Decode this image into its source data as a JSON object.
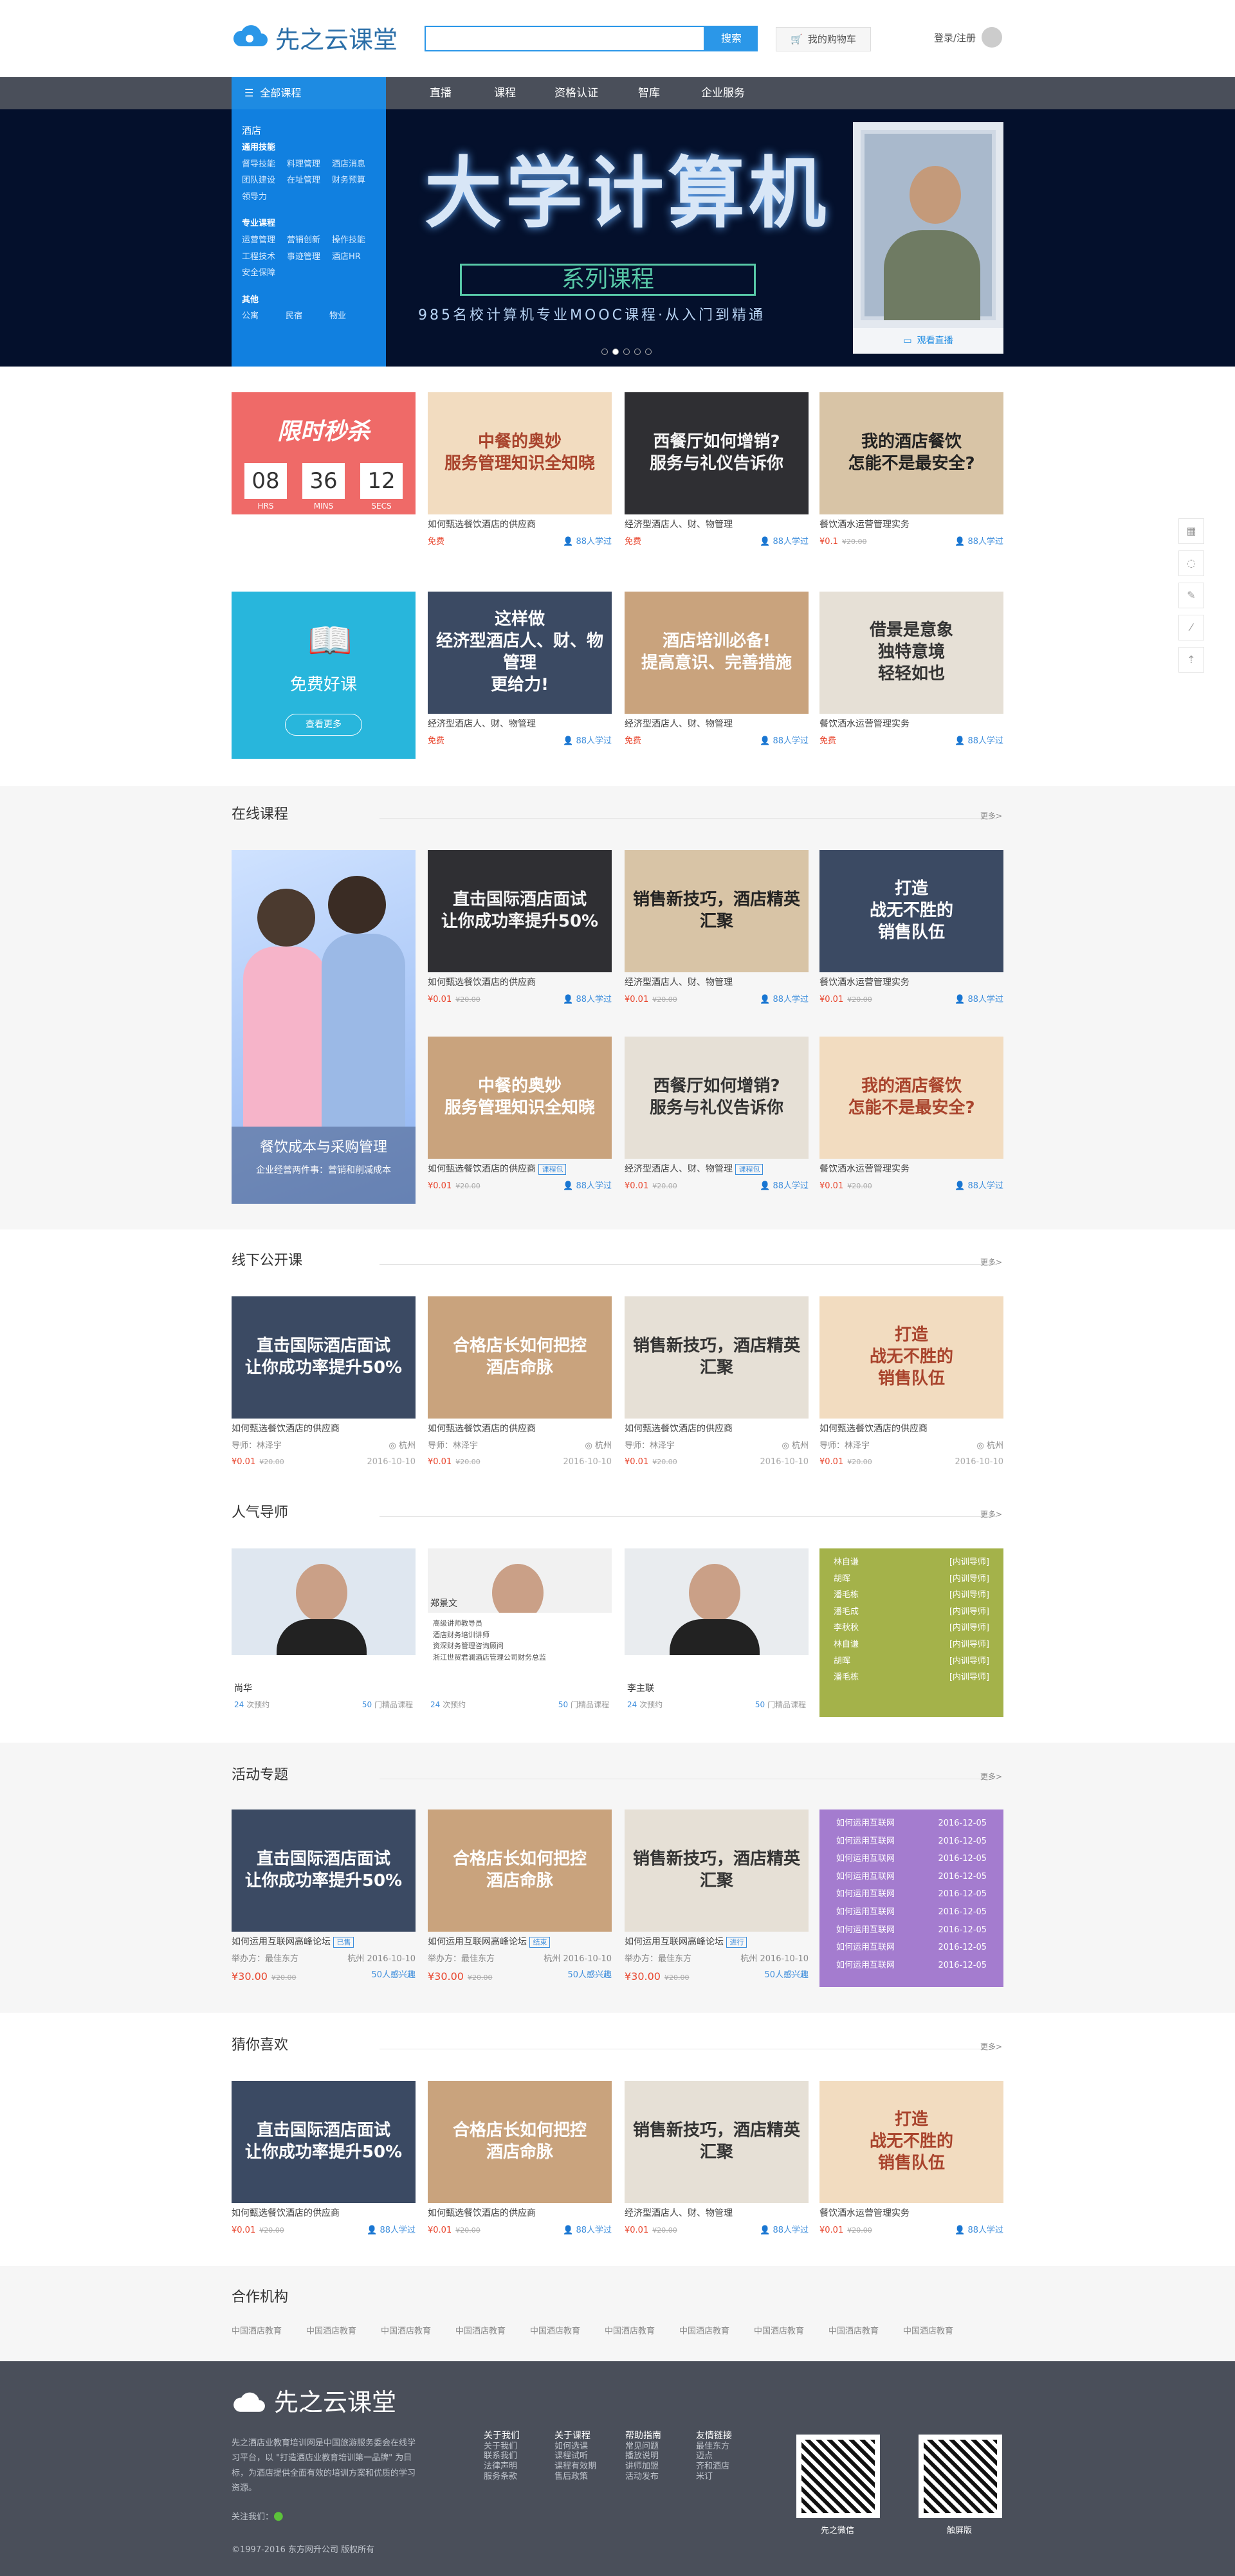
{
  "header": {
    "logo_text": "先之云课堂",
    "search_button": "搜索",
    "cart": "我的购物车",
    "login": "登录/注册"
  },
  "nav": {
    "all": "全部课程",
    "items": [
      "直播",
      "课程",
      "资格认证",
      "智库",
      "企业服务"
    ]
  },
  "sidecat": {
    "g1": "酒店",
    "g1_sub": "通用技能",
    "r1": [
      "督导技能",
      "料理管理",
      "酒店消息"
    ],
    "r2": [
      "团队建设",
      "在址管理",
      "财务预算"
    ],
    "r3": [
      "领导力"
    ],
    "g2": "专业课程",
    "r4": [
      "运营管理",
      "营销创新",
      "操作技能"
    ],
    "r5": [
      "工程技术",
      "事迹管理",
      "酒店HR"
    ],
    "r6": [
      "安全保障"
    ],
    "g3": "其他",
    "r7": [
      "公寓",
      "民宿",
      "物业"
    ]
  },
  "banner": {
    "title": "大学计算机",
    "subtitle": "系列课程",
    "tagline": "985名校计算机专业MOOC课程·从入门到精通",
    "teacher_btn": "观看直播"
  },
  "flash": {
    "title": "限时秒杀",
    "h": "08",
    "m": "36",
    "s": "12",
    "h_l": "HRS",
    "m_l": "MINS",
    "s_l": "SECS"
  },
  "free": {
    "title": "免费好课",
    "btn": "查看更多"
  },
  "row1": [
    {
      "cap": "中餐的奥妙\n服务管理知识全知晓",
      "title": "如何甄选餐饮酒店的供应商",
      "price": "免费",
      "learn": "88人学过"
    },
    {
      "cap": "西餐厅如何增销?\n服务与礼仪告诉你",
      "title": "经济型酒店人、财、物管理",
      "price": "免费",
      "learn": "88人学过"
    },
    {
      "cap": "我的酒店餐饮\n怎能不是最安全?",
      "title": "餐饮酒水运营管理实务",
      "price": "¥0.1",
      "old": "¥20.00",
      "learn": "88人学过"
    }
  ],
  "row2": [
    {
      "cap": "这样做\n经济型酒店人、财、物管理\n更给力!",
      "title": "经济型酒店人、财、物管理",
      "price": "免费",
      "learn": "88人学过"
    },
    {
      "cap": "酒店培训必备!\n提高意识、完善措施",
      "title": "经济型酒店人、财、物管理",
      "price": "免费",
      "learn": "88人学过"
    },
    {
      "cap": "借景是意象\n独特意境\n轻轻如也",
      "title": "餐饮酒水运营管理实务",
      "price": "免费",
      "learn": "88人学过"
    }
  ],
  "online": {
    "title": "在线课程",
    "more": "更多>",
    "promo_title": "餐饮成本与采购管理",
    "promo_sub": "企业经营两件事：营销和削减成本",
    "cards": [
      {
        "cap": "直击国际酒店面试\n让你成功率提升50%",
        "title": "如何甄选餐饮酒店的供应商",
        "price": "¥0.01",
        "old": "¥20.00",
        "learn": "88人学过"
      },
      {
        "cap": "销售新技巧，酒店精英汇聚",
        "title": "经济型酒店人、财、物管理",
        "price": "¥0.01",
        "old": "¥20.00",
        "learn": "88人学过"
      },
      {
        "cap": "打造\n战无不胜的\n销售队伍",
        "title": "餐饮酒水运营管理实务",
        "price": "¥0.01",
        "old": "¥20.00",
        "learn": "88人学过"
      },
      {
        "cap": "中餐的奥妙\n服务管理知识全知晓",
        "title": "如何甄选餐饮酒店的供应商",
        "tag": "课程包",
        "price": "¥0.01",
        "old": "¥20.00",
        "learn": "88人学过"
      },
      {
        "cap": "西餐厅如何增销?\n服务与礼仪告诉你",
        "title": "经济型酒店人、财、物管理",
        "tag": "课程包",
        "price": "¥0.01",
        "old": "¥20.00",
        "learn": "88人学过"
      },
      {
        "cap": "我的酒店餐饮\n怎能不是最安全?",
        "title": "餐饮酒水运营管理实务",
        "price": "¥0.01",
        "old": "¥20.00",
        "learn": "88人学过"
      }
    ]
  },
  "offline": {
    "title": "线下公开课",
    "more": "更多>",
    "cards": [
      {
        "cap": "直击国际酒店面试\n让你成功率提升50%",
        "title": "如何甄选餐饮酒店的供应商",
        "mentor": "导师：林泽宇",
        "city": "杭州",
        "price": "¥0.01",
        "old": "¥20.00",
        "date": "2016-10-10"
      },
      {
        "cap": "合格店长如何把控\n酒店命脉",
        "title": "如何甄选餐饮酒店的供应商",
        "mentor": "导师：林泽宇",
        "city": "杭州",
        "price": "¥0.01",
        "old": "¥20.00",
        "date": "2016-10-10"
      },
      {
        "cap": "销售新技巧，酒店精英汇聚",
        "title": "如何甄选餐饮酒店的供应商",
        "mentor": "导师：林泽宇",
        "city": "杭州",
        "price": "¥0.01",
        "old": "¥20.00",
        "date": "2016-10-10"
      },
      {
        "cap": "打造\n战无不胜的\n销售队伍",
        "title": "如何甄选餐饮酒店的供应商",
        "mentor": "导师：林泽宇",
        "city": "杭州",
        "price": "¥0.01",
        "old": "¥20.00",
        "date": "2016-10-10"
      }
    ]
  },
  "mentors": {
    "title": "人气导师",
    "more": "更多>",
    "list": [
      {
        "name": "尚华",
        "count": "24",
        "count_l": "次预约",
        "courses": "50",
        "courses_l": "门精品课程"
      },
      {
        "name": "郑景文",
        "bio": "高级讲师教导员\n酒店财务培训讲师\n资深财务管理咨询顾问\n浙江世贸君澜酒店管理公司财务总监",
        "count": "24",
        "count_l": "次预约",
        "courses": "50",
        "courses_l": "门精品课程"
      },
      {
        "name": "李主联",
        "count": "24",
        "count_l": "次预约",
        "courses": "50",
        "courses_l": "门精品课程"
      }
    ],
    "grid": [
      [
        "林自谦",
        "[内训导师]"
      ],
      [
        "胡晖",
        "[内训导师]"
      ],
      [
        "潘毛栋",
        "[内训导师]"
      ],
      [
        "潘毛成",
        "[内训导师]"
      ],
      [
        "李秋秋",
        "[内训导师]"
      ],
      [
        "林自谦",
        "[内训导师]"
      ],
      [
        "胡晖",
        "[内训导师]"
      ],
      [
        "潘毛栋",
        "[内训导师]"
      ]
    ]
  },
  "events": {
    "title": "活动专题",
    "more": "更多>",
    "cards": [
      {
        "cap": "直击国际酒店面试\n让你成功率提升50%",
        "title": "如何运用互联网高峰论坛",
        "tag": "已售",
        "host": "举办方：最佳东方",
        "city": "杭州",
        "date": "2016-10-10",
        "price": "¥30.00",
        "old": "¥20.00",
        "interest": "50人感兴趣"
      },
      {
        "cap": "合格店长如何把控\n酒店命脉",
        "title": "如何运用互联网高峰论坛",
        "tag": "结束",
        "host": "举办方：最佳东方",
        "city": "杭州",
        "date": "2016-10-10",
        "price": "¥30.00",
        "old": "¥20.00",
        "interest": "50人感兴趣"
      },
      {
        "cap": "销售新技巧，酒店精英汇聚",
        "title": "如何运用互联网高峰论坛",
        "tag": "进行",
        "host": "举办方：最佳东方",
        "city": "杭州",
        "date": "2016-10-10",
        "price": "¥30.00",
        "old": "¥20.00",
        "interest": "50人感兴趣"
      }
    ],
    "list": [
      [
        "如何运用互联网",
        "2016-12-05"
      ],
      [
        "如何运用互联网",
        "2016-12-05"
      ],
      [
        "如何运用互联网",
        "2016-12-05"
      ],
      [
        "如何运用互联网",
        "2016-12-05"
      ],
      [
        "如何运用互联网",
        "2016-12-05"
      ],
      [
        "如何运用互联网",
        "2016-12-05"
      ],
      [
        "如何运用互联网",
        "2016-12-05"
      ],
      [
        "如何运用互联网",
        "2016-12-05"
      ],
      [
        "如何运用互联网",
        "2016-12-05"
      ]
    ]
  },
  "guess": {
    "title": "猜你喜欢",
    "more": "更多>",
    "cards": [
      {
        "cap": "直击国际酒店面试\n让你成功率提升50%",
        "title": "如何甄选餐饮酒店的供应商",
        "price": "¥0.01",
        "old": "¥20.00",
        "learn": "88人学过"
      },
      {
        "cap": "合格店长如何把控\n酒店命脉",
        "title": "如何甄选餐饮酒店的供应商",
        "price": "¥0.01",
        "old": "¥20.00",
        "learn": "88人学过"
      },
      {
        "cap": "销售新技巧，酒店精英汇聚",
        "title": "经济型酒店人、财、物管理",
        "price": "¥0.01",
        "old": "¥20.00",
        "learn": "88人学过"
      },
      {
        "cap": "打造\n战无不胜的\n销售队伍",
        "title": "餐饮酒水运营管理实务",
        "price": "¥0.01",
        "old": "¥20.00",
        "learn": "88人学过"
      }
    ]
  },
  "partners": {
    "title": "合作机构",
    "items": [
      "中国酒店教育",
      "中国酒店教育",
      "中国酒店教育",
      "中国酒店教育",
      "中国酒店教育",
      "中国酒店教育",
      "中国酒店教育",
      "中国酒店教育",
      "中国酒店教育",
      "中国酒店教育"
    ]
  },
  "footer": {
    "logo": "先之云课堂",
    "about": "先之酒店业教育培训网是中国旅游服务委会在线学习平台，以 \"打造酒店业教育培训第一品牌\" 为目标，为酒店提供全面有效的培训方案和优质的学习资源。",
    "follow": "关注我们：",
    "cols": [
      {
        "h": "关于我们",
        "items": [
          "关于我们",
          "联系我们",
          "法律声明",
          "服务条款"
        ]
      },
      {
        "h": "关于课程",
        "items": [
          "如何选课",
          "课程试听",
          "课程有效期",
          "售后政策"
        ]
      },
      {
        "h": "帮助指南",
        "items": [
          "常见问题",
          "播放说明",
          "讲师加盟",
          "活动发布"
        ]
      },
      {
        "h": "友情链接",
        "items": [
          "最佳东方",
          "迈点",
          "齐和酒店",
          "米订"
        ]
      }
    ],
    "qr1": "先之微信",
    "qr2": "触屏版",
    "copy": "©1997-2016 东方网升公司 版权所有"
  }
}
